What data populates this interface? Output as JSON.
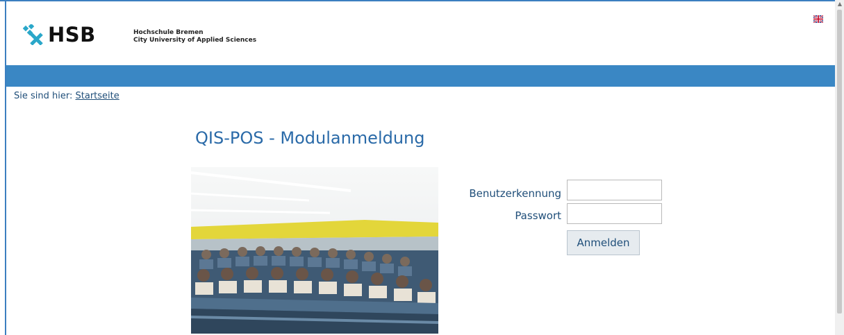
{
  "header": {
    "logo_text": "HSB",
    "uni_name_line1": "Hochschule Bremen",
    "uni_name_line2": "City University of Applied Sciences",
    "language_icon": "uk-flag-icon"
  },
  "breadcrumb": {
    "prefix": "Sie sind hier:",
    "link_label": "Startseite"
  },
  "main": {
    "title": "QIS-POS - Modulanmeldung"
  },
  "login": {
    "username_label": "Benutzerkennung",
    "username_value": "",
    "password_label": "Passwort",
    "password_value": "",
    "submit_label": "Anmelden"
  },
  "colors": {
    "accent": "#3a87c4",
    "text": "#1f4e79",
    "logo_mark": "#2aa7c9"
  }
}
